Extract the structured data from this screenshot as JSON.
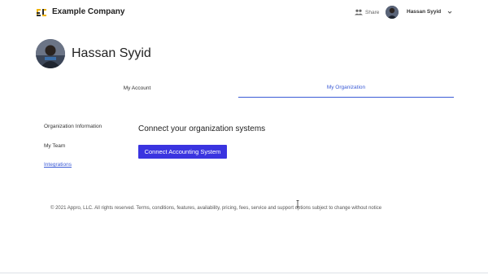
{
  "header": {
    "company_name": "Example Company",
    "share_label": "Share",
    "user_name": "Hassan Syyid"
  },
  "profile": {
    "name": "Hassan Syyid"
  },
  "tabs": [
    {
      "label": "My Account",
      "active": false
    },
    {
      "label": "My Organization",
      "active": true
    }
  ],
  "sidebar": {
    "items": [
      {
        "label": "Organization Information",
        "active": false
      },
      {
        "label": "My Team",
        "active": false
      },
      {
        "label": "Integrations",
        "active": true
      }
    ]
  },
  "main": {
    "section_title": "Connect your organization systems",
    "connect_button": "Connect Accounting System"
  },
  "footer": {
    "text": "© 2021 Appro, LLC. All rights reserved. Terms, conditions, features, availability, pricing, fees, service and support options subject to change without notice"
  },
  "colors": {
    "accent": "#3b5bd6",
    "button": "#3a34e0",
    "logo_yellow": "#f0b400",
    "logo_dark": "#2d2d2d"
  }
}
